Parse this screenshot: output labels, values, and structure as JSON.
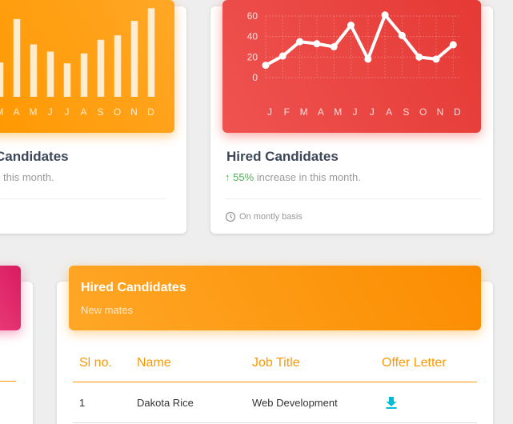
{
  "colors": {
    "orange": "#ff9800",
    "red": "#f44336",
    "green": "#4caf50",
    "download": "#00bcd4"
  },
  "left_card": {
    "title": "Candidates",
    "category": "this month.",
    "footer": ".",
    "chart_data": {
      "type": "bar",
      "categories": [
        "M",
        "A",
        "M",
        "J",
        "J",
        "A",
        "S",
        "O",
        "N",
        "D"
      ],
      "visible_categories": [
        "M",
        "A",
        "M",
        "J",
        "J",
        "A",
        "S",
        "O",
        "N",
        "D"
      ],
      "values": [
        38,
        86,
        58,
        50,
        37,
        48,
        63,
        68,
        84,
        98
      ],
      "ylim": [
        0,
        100
      ]
    }
  },
  "right_card": {
    "title": "Hired Candidates",
    "percent": "55%",
    "category": "increase in this month.",
    "footer": "On montly basis",
    "chart_data": {
      "type": "line",
      "categories": [
        "J",
        "F",
        "M",
        "A",
        "M",
        "J",
        "J",
        "A",
        "S",
        "O",
        "N",
        "D"
      ],
      "values": [
        12,
        21,
        35,
        33,
        30,
        51,
        18,
        61,
        41,
        20,
        18,
        32
      ],
      "yticks": [
        "60",
        "40",
        "20",
        "0"
      ],
      "ylim": [
        0,
        60
      ],
      "grid": true
    }
  },
  "table_card": {
    "title": "Hired Candidates",
    "subtitle": "New mates",
    "columns": [
      "Sl no.",
      "Name",
      "Job Title",
      "Offer Letter"
    ],
    "rows": [
      {
        "sl": "1",
        "name": "Dakota Rice",
        "job": "Web Development",
        "offer": "download-icon"
      }
    ]
  }
}
